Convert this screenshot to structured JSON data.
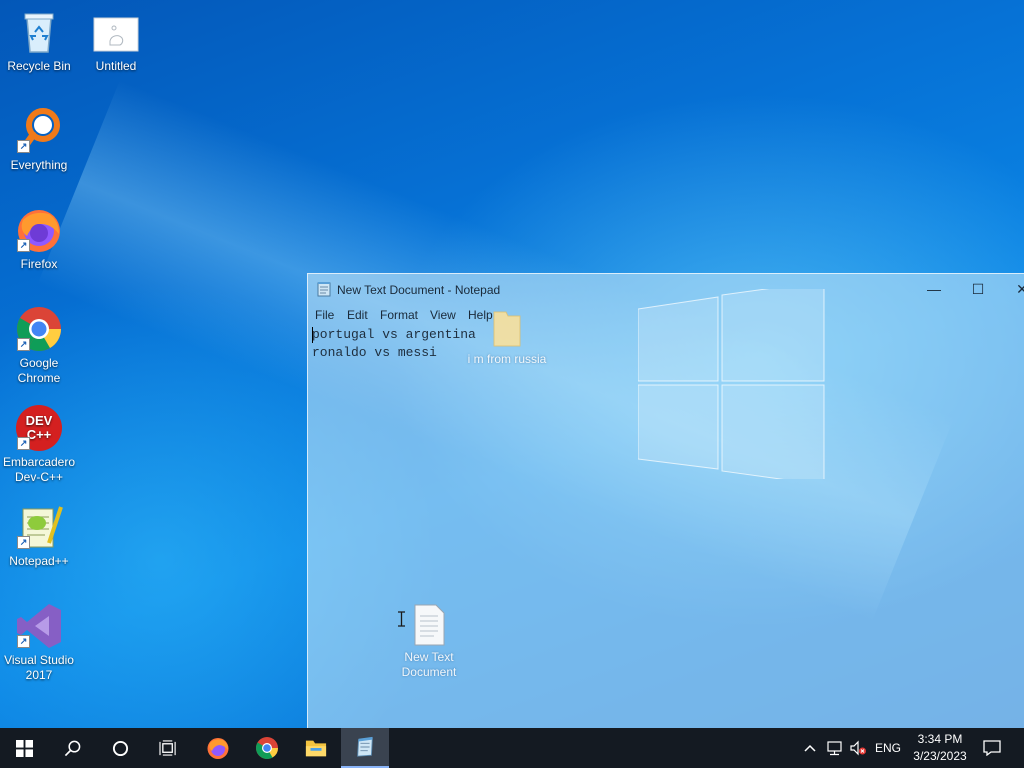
{
  "desktop": {
    "icons": [
      {
        "label": "Recycle Bin",
        "icon": "recycle-bin-icon"
      },
      {
        "label": "Untitled",
        "icon": "image-file-icon"
      },
      {
        "label": "Everything",
        "icon": "everything-search-icon"
      },
      {
        "label": "Firefox",
        "icon": "firefox-icon"
      },
      {
        "label": "Google Chrome",
        "icon": "chrome-icon"
      },
      {
        "label": "Embarcadero Dev-C++",
        "icon": "devcpp-icon"
      },
      {
        "label": "Notepad++",
        "icon": "notepadpp-icon"
      },
      {
        "label": "Visual Studio 2017",
        "icon": "visual-studio-icon"
      }
    ],
    "devcpp_badge": "DEV\nC++",
    "ghost_icons": [
      {
        "label": "i m from russia",
        "icon": "folder-icon"
      },
      {
        "label": "New Text Document",
        "icon": "text-document-icon"
      }
    ]
  },
  "notepad": {
    "title": "New Text Document - Notepad",
    "menu": [
      "File",
      "Edit",
      "Format",
      "View",
      "Help"
    ],
    "content": "portugal vs argentina\nronaldo vs messi",
    "buttons": {
      "minimize": "—",
      "maximize": "☐",
      "close": "✕"
    }
  },
  "taskbar": {
    "pinned": [
      "start-icon",
      "search-icon",
      "cortana-icon",
      "task-view-icon",
      "firefox-icon",
      "chrome-icon",
      "file-explorer-icon",
      "notepad-icon"
    ],
    "tray": {
      "chevron": "^",
      "language": "ENG",
      "time": "3:34 PM",
      "date": "3/23/2023"
    }
  },
  "colors": {
    "taskbar": "#141a22",
    "desktop_blue": "#0a78d8",
    "accent": "#8ab4f8"
  }
}
